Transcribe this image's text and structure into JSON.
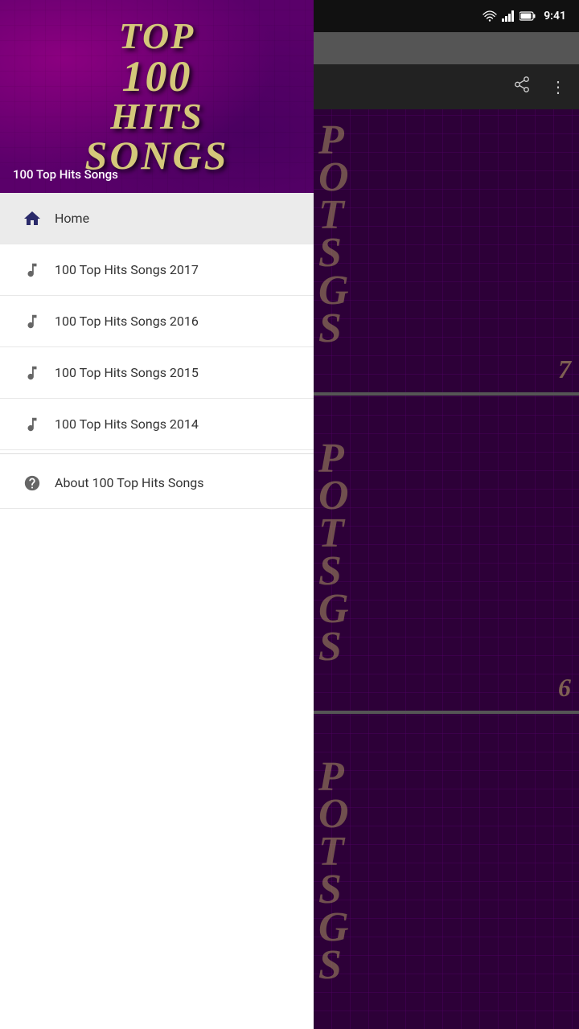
{
  "statusBar": {
    "time": "9:41",
    "icons": [
      "wifi",
      "signal",
      "battery"
    ]
  },
  "appBar": {
    "shareIconLabel": "share",
    "menuIconLabel": "more options"
  },
  "drawer": {
    "headerTitle": {
      "top": "TOP",
      "number": "100",
      "hits": "HITS",
      "songs": "SONGS"
    },
    "headerSubtitle": "100 Top Hits Songs",
    "navItems": [
      {
        "id": "home",
        "label": "Home",
        "icon": "home",
        "active": true
      },
      {
        "id": "2017",
        "label": "100 Top Hits Songs 2017",
        "icon": "music-note",
        "active": false
      },
      {
        "id": "2016",
        "label": "100 Top Hits Songs 2016",
        "icon": "music-note",
        "active": false
      },
      {
        "id": "2015",
        "label": "100 Top Hits Songs 2015",
        "icon": "music-note",
        "active": false
      },
      {
        "id": "2014",
        "label": "100 Top Hits Songs 2014",
        "icon": "music-note",
        "active": false
      }
    ],
    "aboutItem": {
      "id": "about",
      "label": "About 100 Top Hits Songs",
      "icon": "help"
    }
  },
  "contentCards": [
    {
      "letters": [
        "P",
        "O",
        "T",
        "S",
        "G",
        "S"
      ],
      "year": "7"
    },
    {
      "letters": [
        "P",
        "O",
        "T",
        "S",
        "G",
        "S"
      ],
      "year": "6"
    },
    {
      "letters": [
        "P",
        "O",
        "T",
        "S",
        "G",
        "S"
      ],
      "year": ""
    }
  ]
}
